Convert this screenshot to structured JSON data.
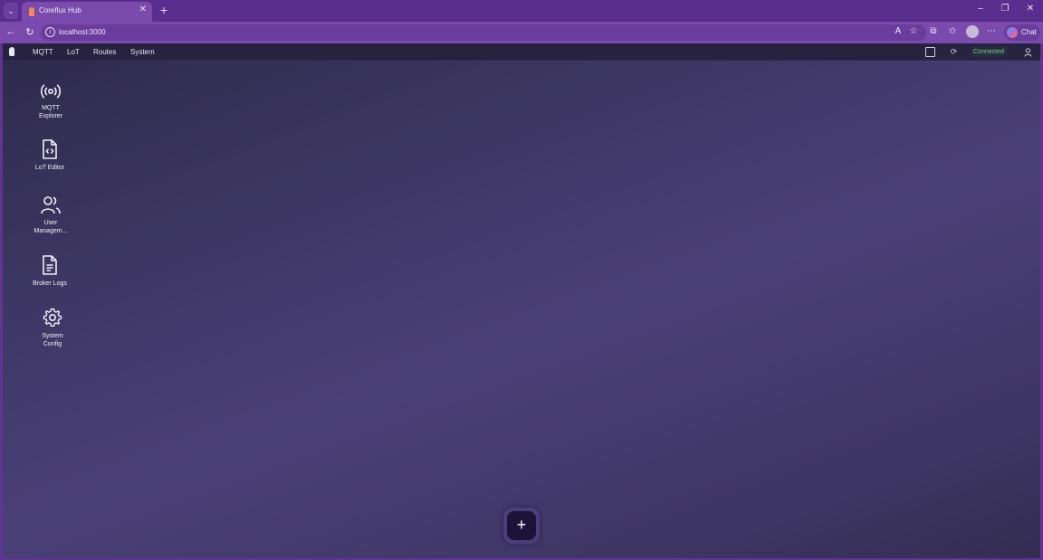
{
  "browser": {
    "tab_title": "Coreflux Hub",
    "tab_close": "✕",
    "new_tab": "+",
    "url": "localhost:3000",
    "chat_label": "Chat",
    "window_controls": {
      "minimize": "–",
      "restore": "❐",
      "close": "✕"
    }
  },
  "app": {
    "menu": [
      {
        "label": "MQTT"
      },
      {
        "label": "LoT"
      },
      {
        "label": "Routes"
      },
      {
        "label": "System"
      }
    ],
    "status": "Connected",
    "status_color": "#6fd67a"
  },
  "desktop": {
    "items": [
      {
        "label": "MQTT\nExplorer",
        "icon": "broadcast-icon"
      },
      {
        "label": "LoT Editor",
        "icon": "code-file-icon"
      },
      {
        "label": "User\nManagem...",
        "icon": "users-icon"
      },
      {
        "label": "Broker Logs",
        "icon": "document-icon"
      },
      {
        "label": "System\nConfig",
        "icon": "gear-icon"
      }
    ]
  },
  "fab": {
    "label": "+"
  }
}
